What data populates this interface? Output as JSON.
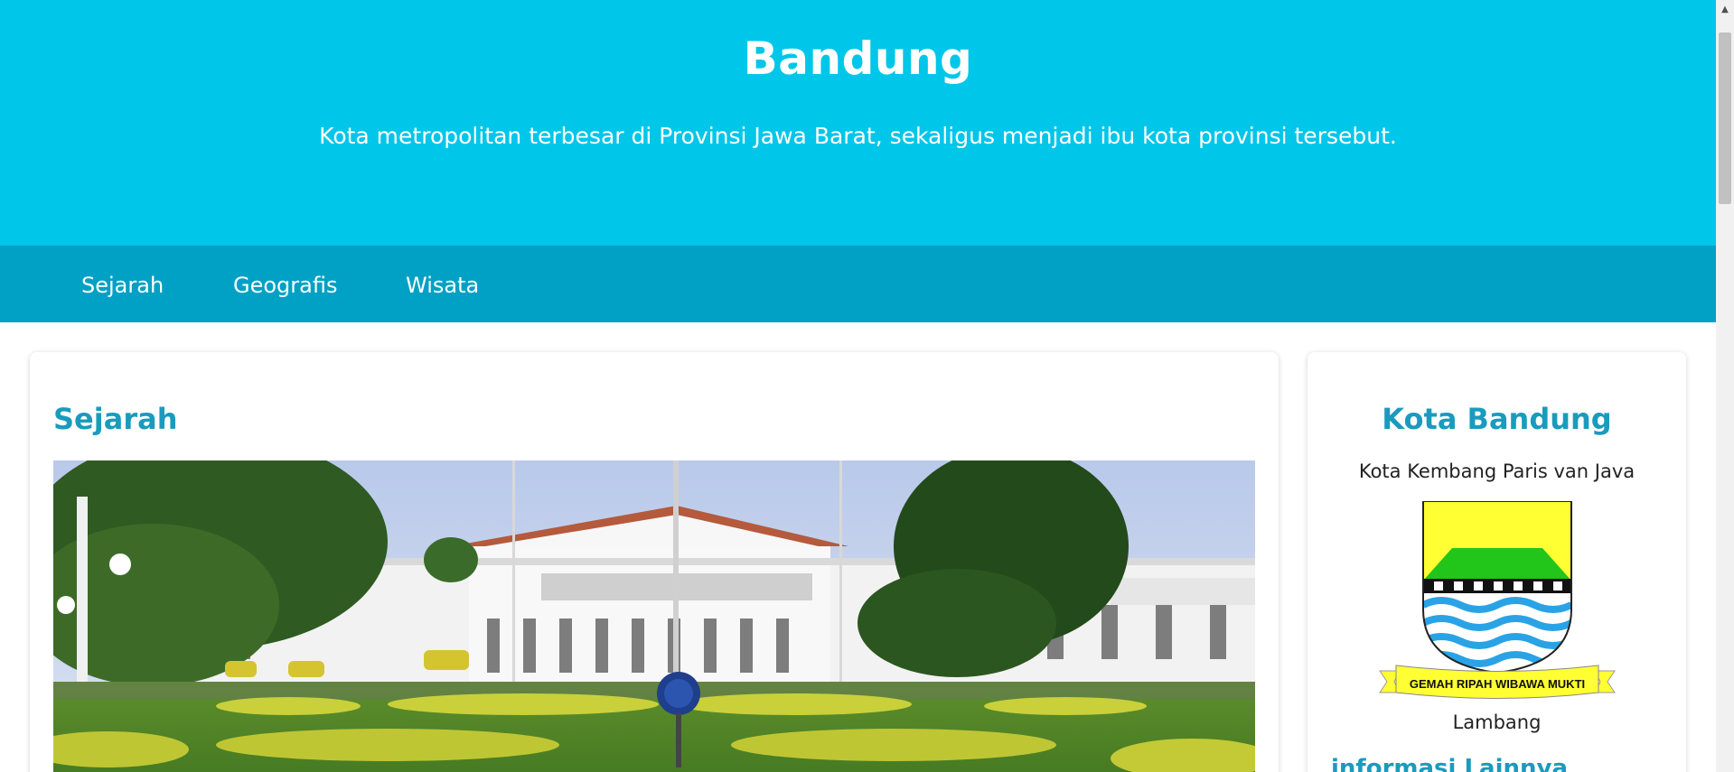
{
  "header": {
    "title": "Bandung",
    "tagline": "Kota metropolitan terbesar di Provinsi Jawa Barat, sekaligus menjadi ibu kota provinsi tersebut."
  },
  "nav": {
    "items": [
      {
        "label": "Sejarah"
      },
      {
        "label": "Geografis"
      },
      {
        "label": "Wisata"
      }
    ]
  },
  "main": {
    "section_title": "Sejarah",
    "photo_icon": "building-photo"
  },
  "sidebar": {
    "title": "Kota Bandung",
    "subtitle": "Kota Kembang Paris van Java",
    "emblem_motto": "GEMAH RIPAH WIBAWA MUKTI",
    "emblem_caption": "Lambang",
    "more_info": "informasi Lainnya"
  },
  "colors": {
    "header_bg": "#00c6e9",
    "nav_bg": "#00a1c4",
    "accent": "#1a9bbd"
  }
}
